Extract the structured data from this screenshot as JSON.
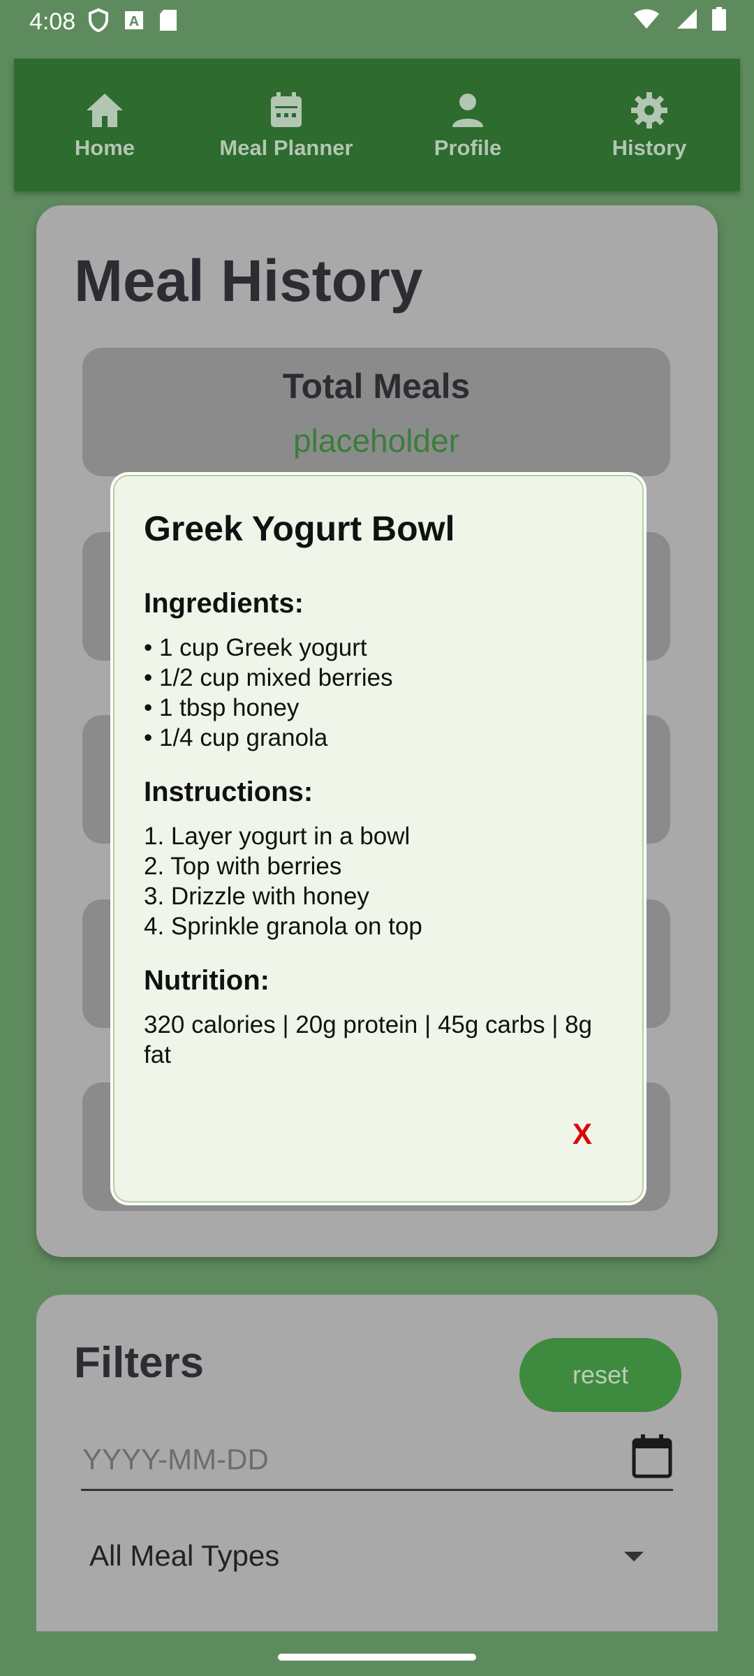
{
  "status_bar": {
    "time": "4:08",
    "left_icons": [
      "shield-icon",
      "keyboard-a-icon",
      "sd-card-icon"
    ],
    "right_icons": [
      "wifi-icon",
      "signal-icon",
      "battery-icon"
    ]
  },
  "nav": {
    "items": [
      {
        "label": "Home",
        "icon": "home-icon"
      },
      {
        "label": "Meal Planner",
        "icon": "calendar-icon"
      },
      {
        "label": "Profile",
        "icon": "person-icon"
      },
      {
        "label": "History",
        "icon": "gear-icon"
      }
    ]
  },
  "history": {
    "title": "Meal History",
    "stats": [
      {
        "label": "Total Meals",
        "value": "placeholder"
      }
    ]
  },
  "modal": {
    "title": "Greek Yogurt Bowl",
    "ingredients_heading": "Ingredients:",
    "ingredients": [
      "• 1 cup Greek yogurt",
      "• 1/2 cup mixed berries",
      "• 1 tbsp honey",
      "• 1/4 cup granola"
    ],
    "instructions_heading": "Instructions:",
    "instructions": [
      "1. Layer yogurt in a bowl",
      "2. Top with berries",
      "3. Drizzle with honey",
      "4. Sprinkle granola on top"
    ],
    "nutrition_heading": "Nutrition:",
    "nutrition": "320 calories | 20g protein | 45g carbs | 8g fat",
    "close_label": "X"
  },
  "filters": {
    "title": "Filters",
    "reset_label": "reset",
    "date_placeholder": "YYYY-MM-DD",
    "meal_type": "All Meal Types"
  },
  "colors": {
    "nav_bg": "#2d6b2f",
    "accent_green": "#3e8a3f",
    "modal_bg": "#eff5e9",
    "close_red": "#e00000"
  }
}
